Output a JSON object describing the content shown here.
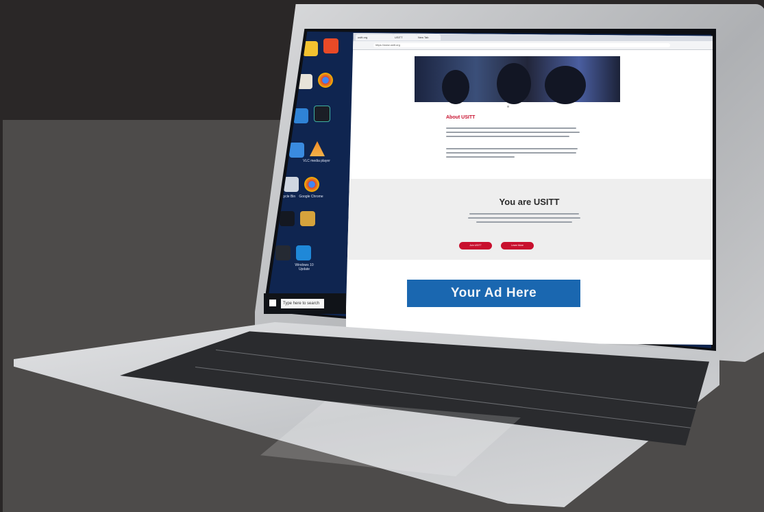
{
  "browser": {
    "tabs": [
      "usitt.org",
      "USITT",
      "New Tab"
    ],
    "url": "https://www.usitt.org"
  },
  "page": {
    "about_title": "About USITT",
    "you_title": "You are USITT",
    "button_1": "Join USITT",
    "button_2": "Learn More",
    "ad_text": "Your Ad Here"
  },
  "taskbar": {
    "search_placeholder": "Type here to search"
  },
  "desktop_icons": [
    "Recycle Bin",
    "Google Chrome",
    "Firefox",
    "VLC media player",
    "Windows 10 Update"
  ],
  "colors": {
    "accent": "#c8102e",
    "ad_blue": "#1a67b0",
    "background": "#4d4b4a"
  }
}
